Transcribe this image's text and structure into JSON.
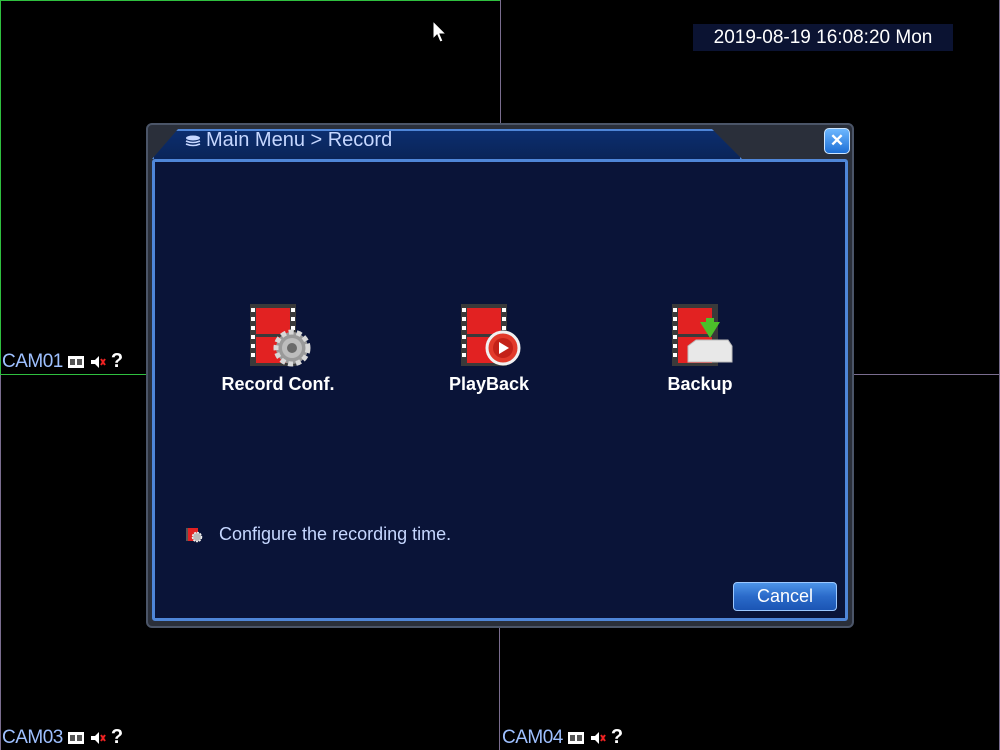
{
  "datetime": "2019-08-19 16:08:20 Mon",
  "cameras": [
    {
      "name": "CAM01"
    },
    {
      "name": "CAM03"
    },
    {
      "name": "CAM04"
    }
  ],
  "help_mark": "?",
  "dialog": {
    "breadcrumb": "Main Menu > Record",
    "close_glyph": "✕",
    "items": [
      {
        "label": "Record Conf.",
        "icon": "film-gear-icon"
      },
      {
        "label": "PlayBack",
        "icon": "film-play-icon"
      },
      {
        "label": "Backup",
        "icon": "film-download-icon"
      }
    ],
    "hint": "Configure the recording time.",
    "cancel_label": "Cancel"
  },
  "colors": {
    "panel_bg": "#0a1438",
    "panel_border": "#4f86d8",
    "cam_label": "#8fb8ff",
    "grid_green": "#2fbf3f",
    "grid_purple": "#7a6d8f"
  }
}
